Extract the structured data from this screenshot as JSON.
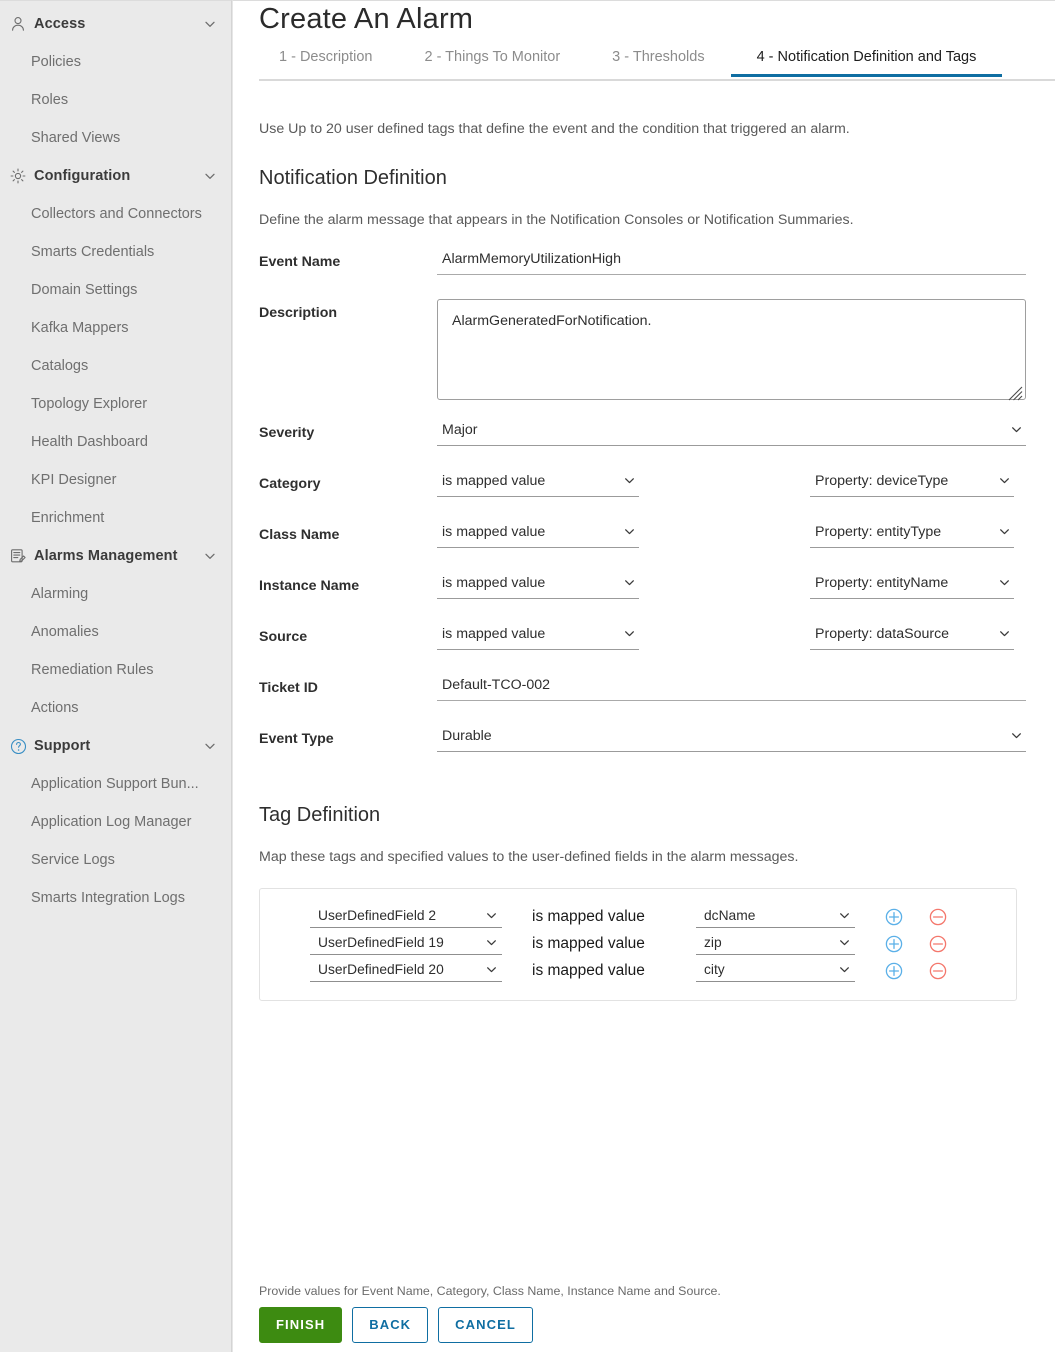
{
  "sidebar": {
    "groups": [
      {
        "label": "Access",
        "icon": "user-icon",
        "items": [
          {
            "label": "Policies"
          },
          {
            "label": "Roles"
          },
          {
            "label": "Shared Views"
          }
        ]
      },
      {
        "label": "Configuration",
        "icon": "gear-icon",
        "items": [
          {
            "label": "Collectors and Connectors"
          },
          {
            "label": "Smarts Credentials"
          },
          {
            "label": "Domain Settings"
          },
          {
            "label": "Kafka Mappers"
          },
          {
            "label": "Catalogs"
          },
          {
            "label": "Topology Explorer"
          },
          {
            "label": "Health Dashboard"
          },
          {
            "label": "KPI Designer"
          },
          {
            "label": "Enrichment"
          }
        ]
      },
      {
        "label": "Alarms Management",
        "icon": "alarms-list-icon",
        "items": [
          {
            "label": "Alarming"
          },
          {
            "label": "Anomalies"
          },
          {
            "label": "Remediation Rules"
          },
          {
            "label": "Actions"
          }
        ]
      },
      {
        "label": "Support",
        "icon": "question-circle-icon",
        "items": [
          {
            "label": "Application Support Bun..."
          },
          {
            "label": "Application Log Manager"
          },
          {
            "label": "Service Logs"
          },
          {
            "label": "Smarts Integration Logs"
          }
        ]
      }
    ]
  },
  "header": {
    "title": "Create An Alarm",
    "tabs": [
      {
        "label": "1 - Description",
        "active": false
      },
      {
        "label": "2 - Things To Monitor",
        "active": false
      },
      {
        "label": "3 - Thresholds",
        "active": false
      },
      {
        "label": "4 - Notification Definition and Tags",
        "active": true
      }
    ]
  },
  "main": {
    "intro": "Use Up to 20 user defined tags that define the event and the condition that triggered an alarm.",
    "notification": {
      "section_title": "Notification Definition",
      "section_sub": "Define the alarm message that appears in the Notification Consoles or Notification Summaries.",
      "event_name_label": "Event Name",
      "event_name_value": "AlarmMemoryUtilizationHigh",
      "event_name_placeholder": "",
      "description_label": "Description",
      "description_value": "AlarmGeneratedForNotification.",
      "description_placeholder": "",
      "severity_label": "Severity",
      "severity_value": "Major",
      "category_label": "Category",
      "category_mode": "is mapped value",
      "category_property": "Property: deviceType",
      "class_name_label": "Class Name",
      "class_name_mode": "is mapped value",
      "class_name_property": "Property: entityType",
      "instance_name_label": "Instance Name",
      "instance_name_mode": "is mapped value",
      "instance_name_property": "Property: entityName",
      "source_label": "Source",
      "source_mode": "is mapped value",
      "source_property": "Property: dataSource",
      "ticket_id_label": "Ticket ID",
      "ticket_id_value": "Default-TCO-002",
      "ticket_id_placeholder": "",
      "event_type_label": "Event Type",
      "event_type_value": "Durable"
    },
    "tag_definition": {
      "section_title": "Tag Definition",
      "section_sub": "Map these tags and specified values to the user-defined fields in the alarm messages.",
      "rows": [
        {
          "field": "UserDefinedField 2",
          "operator": "is mapped value",
          "value": "dcName",
          "add_icon": "plus-circle-icon",
          "remove_icon": "minus-circle-icon"
        },
        {
          "field": "UserDefinedField 19",
          "operator": "is mapped value",
          "value": "zip",
          "add_icon": "plus-circle-icon",
          "remove_icon": "minus-circle-icon"
        },
        {
          "field": "UserDefinedField 20",
          "operator": "is mapped value",
          "value": "city",
          "add_icon": "plus-circle-icon",
          "remove_icon": "minus-circle-icon"
        }
      ]
    }
  },
  "footer": {
    "note": "Provide values for Event Name, Category, Class Name, Instance Name and Source.",
    "finish_label": "FINISH",
    "back_label": "BACK",
    "cancel_label": "CANCEL"
  },
  "colors": {
    "accent_blue": "#0f6ea2",
    "finish_green": "#3d8b11",
    "add_icon_blue": "#5bb0e8",
    "remove_icon_red": "#f4776c",
    "sidebar_bg": "#eaeaea"
  }
}
